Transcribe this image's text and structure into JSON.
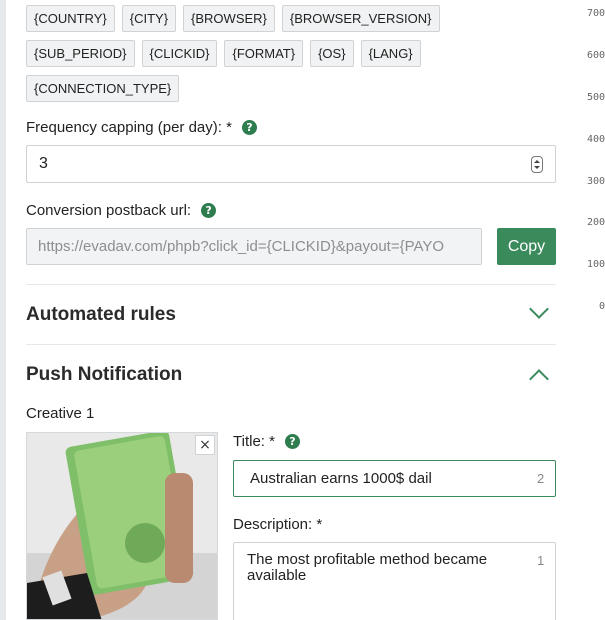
{
  "macros": {
    "row1": [
      "{COUNTRY}",
      "{CITY}",
      "{BROWSER}",
      "{BROWSER_VERSION}"
    ],
    "row2": [
      "{SUB_PERIOD}",
      "{CLICKID}",
      "{FORMAT}",
      "{OS}",
      "{LANG}"
    ],
    "row3": [
      "{CONNECTION_TYPE}"
    ]
  },
  "frequency": {
    "label": "Frequency capping (per day): *",
    "value": "3"
  },
  "postback": {
    "label": "Conversion postback url:",
    "value": "https://evadav.com/phpb?click_id={CLICKID}&payout={PAYO",
    "copy_label": "Copy"
  },
  "automated_rules": {
    "title": "Automated rules"
  },
  "push_notification": {
    "title": "Push Notification",
    "creative_label": "Creative 1",
    "close_symbol": "×",
    "title_field": {
      "label": "Title: *",
      "value": "Australian earns 1000$ dail",
      "counter": "2"
    },
    "description_field": {
      "label": "Description: *",
      "value": "The most profitable method became available",
      "counter": "1"
    }
  },
  "chart_axis": {
    "ticks": [
      "700",
      "600",
      "500",
      "400",
      "300",
      "200",
      "100",
      "0"
    ]
  },
  "colors": {
    "accent": "#3a8a5c",
    "help_icon": "#2e7d4f"
  },
  "icons": {
    "help": "help-icon",
    "expand": "chevron-down-icon",
    "collapse": "chevron-up-icon",
    "stepper": "number-stepper-icon",
    "close": "close-icon"
  }
}
